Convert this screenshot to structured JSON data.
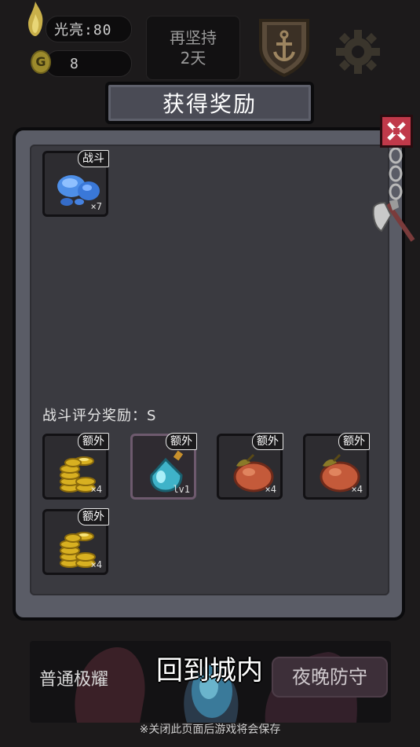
{
  "hud": {
    "brightness_label": "光亮:80",
    "gold_icon_letter": "G",
    "gold_value": "8",
    "persist_line1": "再坚持",
    "persist_line2": "2天"
  },
  "dialog": {
    "title": "获得奖励",
    "battle_rewards": [
      {
        "item": "blue-slime-gel",
        "tag": "战斗",
        "qty": "×7"
      }
    ],
    "rating_label": "战斗评分奖励：S",
    "bonus_rewards": [
      {
        "item": "gold-coins",
        "tag": "额外",
        "qty": "×4"
      },
      {
        "item": "blue-potion",
        "tag": "额外",
        "qty": "lv1"
      },
      {
        "item": "orange-fruit",
        "tag": "额外",
        "qty": "×4"
      },
      {
        "item": "orange-fruit",
        "tag": "额外",
        "qty": "×4"
      },
      {
        "item": "gold-coins",
        "tag": "额外",
        "qty": "×4"
      }
    ]
  },
  "bottom": {
    "normal_label": "普通极耀",
    "return_label": "回到城内",
    "night_label": "夜晚防守",
    "note": "※关闭此页面后游戏将会保存"
  },
  "colors": {
    "close_button": "#c0394a",
    "panel_frame": "#5a5c66",
    "panel_fill": "#3a3a40",
    "title_tab": "#4a4b55"
  }
}
